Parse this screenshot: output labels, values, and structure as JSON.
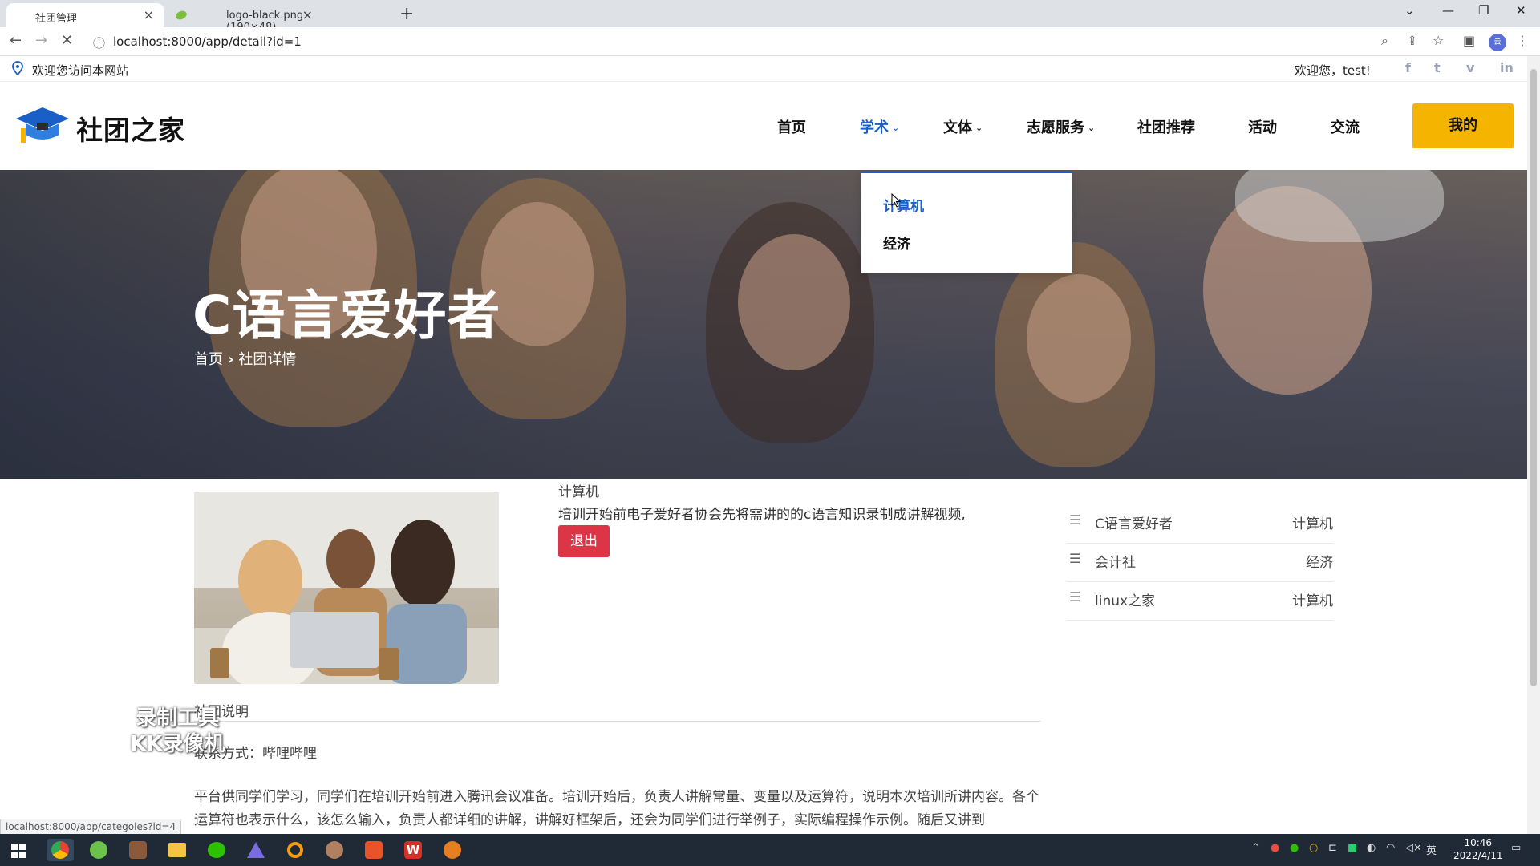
{
  "browser": {
    "tabs": [
      {
        "title": "社团管理",
        "active": true
      },
      {
        "title": "logo-black.png (190×48)",
        "active": false
      }
    ],
    "url": "localhost:8000/app/detail?id=1",
    "status_url": "localhost:8000/app/categoies?id=4"
  },
  "infobar": {
    "site_welcome": "欢迎您访问本网站",
    "user_welcome": "欢迎您，test!",
    "social_icons": [
      "facebook-icon",
      "twitter-icon",
      "vimeo-icon",
      "linkedin-icon"
    ]
  },
  "header": {
    "logo_text": "社团之家",
    "nav": [
      {
        "label": "首页"
      },
      {
        "label": "学术",
        "dropdown": true,
        "active": true
      },
      {
        "label": "文体",
        "dropdown": true
      },
      {
        "label": "志愿服务",
        "dropdown": true
      },
      {
        "label": "社团推荐"
      },
      {
        "label": "活动"
      },
      {
        "label": "交流"
      }
    ],
    "mine_button": "我的",
    "accent": "#f4b400",
    "active_color": "#1a5fc7"
  },
  "dropdown": {
    "items": [
      "计算机",
      "经济"
    ]
  },
  "hero": {
    "title": "C语言爱好者",
    "breadcrumb": [
      "首页",
      "社团详情"
    ]
  },
  "club": {
    "category": "计算机",
    "description": "培训开始前电子爱好者协会先将需讲的的c语言知识录制成讲解视频,",
    "quit_button": "退出",
    "quit_color": "#dc3545"
  },
  "sidebar": {
    "items": [
      {
        "name": "C语言爱好者",
        "category": "计算机"
      },
      {
        "name": "会计社",
        "category": "经济"
      },
      {
        "name": "linux之家",
        "category": "计算机"
      }
    ]
  },
  "section": {
    "title": "社团说明",
    "contact": "联系方式：哔哩哔哩",
    "paragraph": "平台供同学们学习，同学们在培训开始前进入腾讯会议准备。培训开始后，负责人讲解常量、变量以及运算符，说明本次培训所讲内容。各个运算符也表示什么，该怎么输入，负责人都详细的讲解，讲解好框架后，还会为同学们进行举例子，实际编程操作示例。随后又讲到"
  },
  "watermark": {
    "line1": "录制工具",
    "line2": "KK录像机"
  },
  "taskbar": {
    "time": "10:46",
    "date": "2022/4/11",
    "ime": "英"
  }
}
